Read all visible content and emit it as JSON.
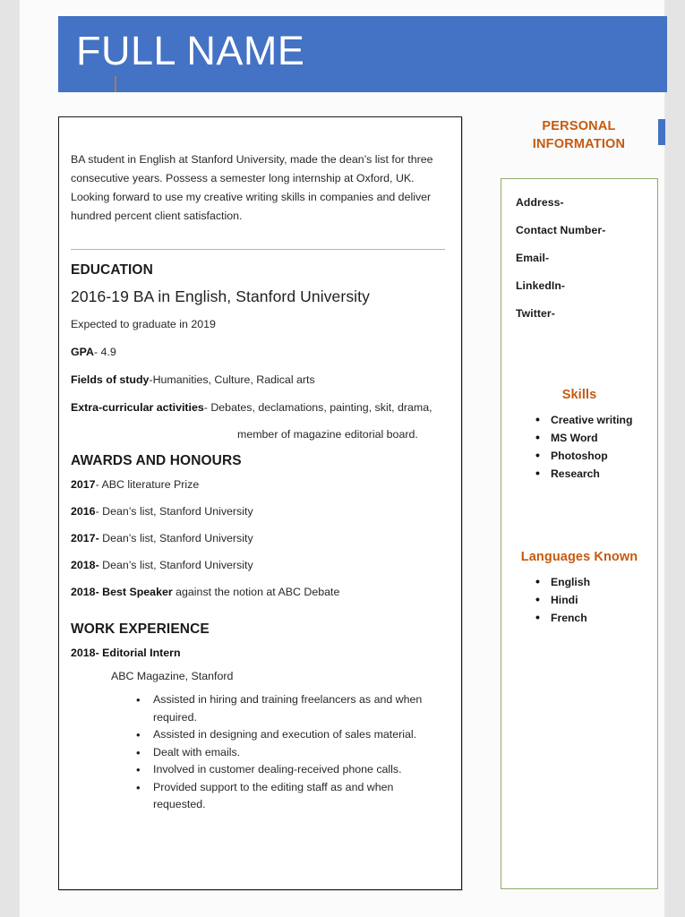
{
  "header": {
    "name": "FULL NAME",
    "banner_color": "#4472C4",
    "name_color": "#FFFFFF",
    "tick_color": "#9D7F52"
  },
  "main": {
    "summary": "BA student in English at Stanford University, made the dean’s list for three consecutive years. Possess a semester long internship at Oxford, UK. Looking forward to use my creative writing skills in companies and deliver hundred percent client satisfaction.",
    "divider_color": "#A9C47F",
    "education": {
      "heading": "EDUCATION",
      "degree": "2016-19 BA in English, Stanford University",
      "graduation": "Expected to graduate in 2019",
      "gpa_label": "GPA",
      "gpa_value": "- 4.9",
      "fields_label": "Fields of study",
      "fields_value": "-Humanities, Culture, Radical arts",
      "extra_label": "Extra-curricular activities",
      "extra_value": "- Debates, declamations, painting, skit, drama,",
      "extra_continuation": "member of magazine editorial board."
    },
    "awards": {
      "heading": "AWARDS AND HONOURS",
      "items": [
        {
          "year": "2017",
          "sep": "- ",
          "text": "ABC literature Prize",
          "bold_text": ""
        },
        {
          "year": "2016",
          "sep": "- ",
          "text": "Dean’s list, Stanford University",
          "bold_text": ""
        },
        {
          "year": "2017-",
          "sep": " ",
          "text": "Dean’s list, Stanford University",
          "bold_text": ""
        },
        {
          "year": "2018-",
          "sep": " ",
          "text": "Dean’s list, Stanford University",
          "bold_text": ""
        },
        {
          "year": "2018-",
          "sep": " ",
          "text": " against the notion at ABC Debate",
          "bold_text": "Best Speaker"
        }
      ]
    },
    "work": {
      "heading": "WORK EXPERIENCE",
      "job_title": "2018- Editorial Intern",
      "organization": "ABC Magazine, Stanford",
      "bullets": [
        "Assisted in hiring and training freelancers as and when required.",
        "Assisted in designing and execution of sales material.",
        "Dealt with emails.",
        "Involved in customer dealing-received phone calls.",
        "Provided support to the editing staff as and when requested."
      ]
    }
  },
  "sidebar": {
    "heading": "PERSONAL INFORMATION",
    "heading_color": "#C55A11",
    "marker_color": "#4472C4",
    "box_border_color": "#8FAA6A",
    "contact_items": [
      "Address-",
      "Contact Number-",
      "Email-",
      "LinkedIn-",
      "Twitter-"
    ],
    "skills": {
      "title": "Skills",
      "items": [
        "Creative writing",
        "MS Word",
        "Photoshop",
        "Research"
      ]
    },
    "languages": {
      "title": "Languages Known",
      "items": [
        "English",
        "Hindi",
        "French"
      ]
    }
  }
}
